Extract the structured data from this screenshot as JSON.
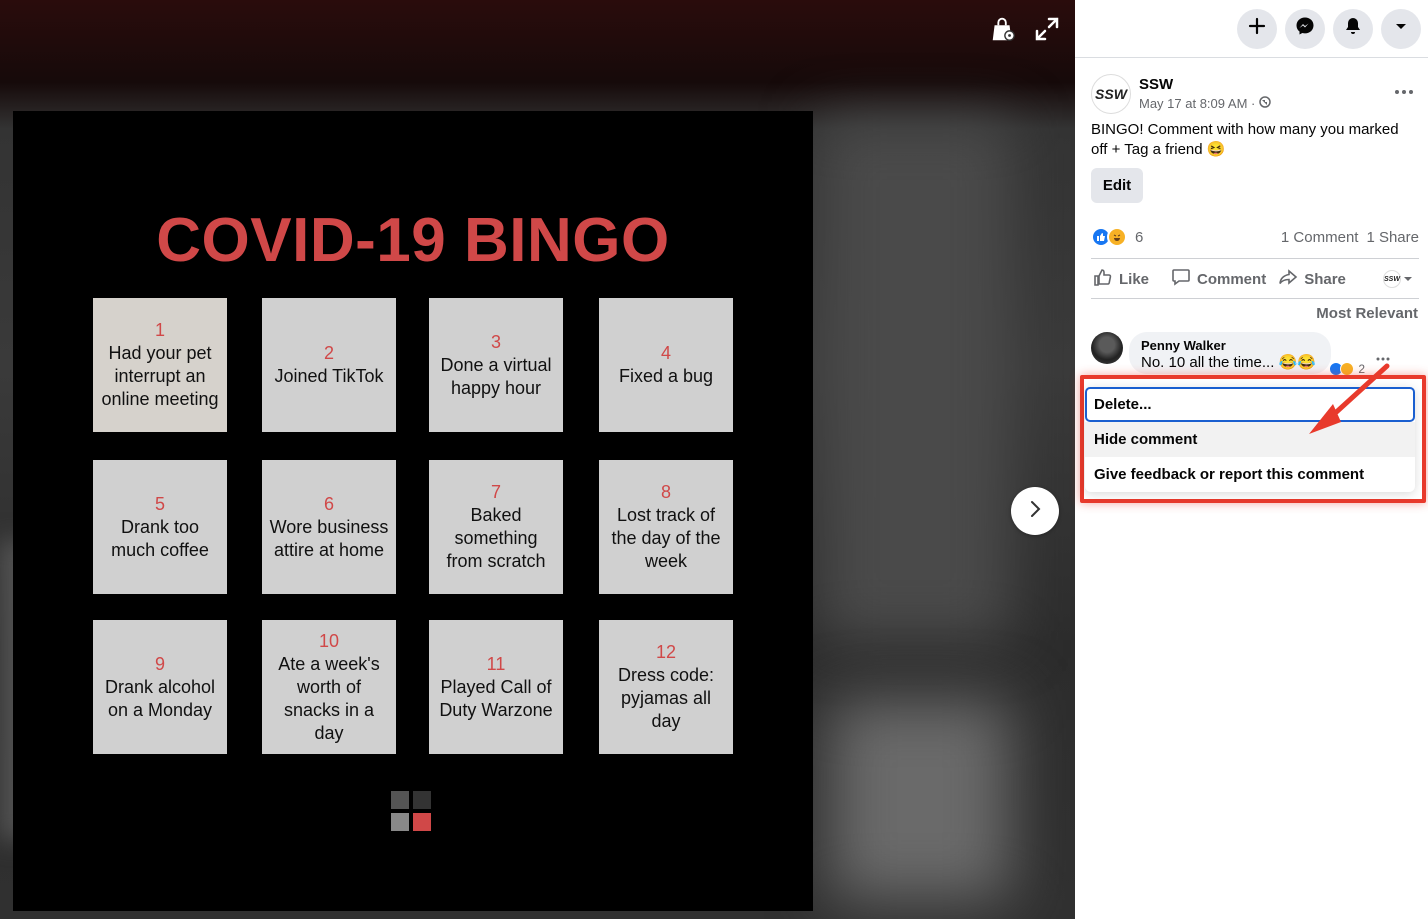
{
  "viewer": {
    "bingo": {
      "title": "COVID-19 BINGO",
      "cells": [
        {
          "num": "1",
          "text": "Had your pet interrupt an online meeting"
        },
        {
          "num": "2",
          "text": "Joined TikTok"
        },
        {
          "num": "3",
          "text": "Done a virtual happy hour"
        },
        {
          "num": "4",
          "text": "Fixed a bug"
        },
        {
          "num": "5",
          "text": "Drank too much coffee"
        },
        {
          "num": "6",
          "text": "Wore business attire at home"
        },
        {
          "num": "7",
          "text": "Baked something from scratch"
        },
        {
          "num": "8",
          "text": "Lost track of the day of the week"
        },
        {
          "num": "9",
          "text": "Drank alcohol on a Monday"
        },
        {
          "num": "10",
          "text": "Ate a week's worth of snacks in a day"
        },
        {
          "num": "11",
          "text": "Played Call of Duty Warzone"
        },
        {
          "num": "12",
          "text": "Dress code: pyjamas all day"
        }
      ]
    },
    "icons": [
      "shopping-bag-tag-icon",
      "expand-icon",
      "chevron-right-icon"
    ]
  },
  "topbar": {
    "buttons": [
      "plus-icon",
      "messenger-icon",
      "bell-icon",
      "caret-down-icon"
    ]
  },
  "post": {
    "page_name": "SSW",
    "avatar_text": "SSW",
    "timestamp": "May 17 at 8:09 AM · ",
    "text": "BINGO! Comment with how many you marked off + Tag a friend 😆",
    "edit_label": "Edit",
    "reaction_count": "6",
    "comments_count": "1 Comment",
    "shares_count": "1 Share",
    "actions": {
      "like": "Like",
      "comment": "Comment",
      "share": "Share",
      "page_avatar_small": "SSW"
    },
    "sort_label": "Most Relevant"
  },
  "comment": {
    "author": "Penny Walker",
    "text": "No. 10 all the time... 😂😂",
    "reaction_count": "2"
  },
  "menu": {
    "items": [
      "Delete...",
      "Hide comment",
      "Give feedback or report this comment"
    ]
  },
  "colors": {
    "accent_red": "#d04848",
    "highlight_red": "#e83a2c",
    "focus_blue": "#1a5fd0",
    "like_blue": "#1877f2"
  }
}
